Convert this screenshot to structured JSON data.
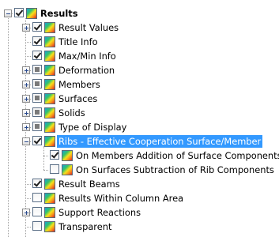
{
  "tree": [
    {
      "label": "Results",
      "level": 0,
      "expander": "expanded",
      "check": "checked",
      "bold": true
    },
    {
      "label": "Result Values",
      "level": 1,
      "expander": "collapsed",
      "check": "checked"
    },
    {
      "label": "Title Info",
      "level": 1,
      "expander": "none",
      "check": "checked"
    },
    {
      "label": "Max/Min Info",
      "level": 1,
      "expander": "none",
      "check": "checked"
    },
    {
      "label": "Deformation",
      "level": 1,
      "expander": "collapsed",
      "check": "partial"
    },
    {
      "label": "Members",
      "level": 1,
      "expander": "collapsed",
      "check": "partial"
    },
    {
      "label": "Surfaces",
      "level": 1,
      "expander": "collapsed",
      "check": "partial"
    },
    {
      "label": "Solids",
      "level": 1,
      "expander": "collapsed",
      "check": "partial"
    },
    {
      "label": "Type of Display",
      "level": 1,
      "expander": "collapsed",
      "check": "partial"
    },
    {
      "label": "Ribs - Effective Cooperation Surface/Member",
      "level": 1,
      "expander": "expanded",
      "check": "checked",
      "selected": true
    },
    {
      "label": "On Members Addition of Surface Components",
      "level": 2,
      "expander": "none",
      "check": "checked"
    },
    {
      "label": "On Surfaces Subtraction of Rib Components",
      "level": 2,
      "expander": "none",
      "check": "unchecked"
    },
    {
      "label": "Result Beams",
      "level": 1,
      "expander": "none",
      "check": "checked"
    },
    {
      "label": "Results Within Column Area",
      "level": 1,
      "expander": "none",
      "check": "unchecked"
    },
    {
      "label": "Support Reactions",
      "level": 1,
      "expander": "collapsed",
      "check": "unchecked"
    },
    {
      "label": "Transparent",
      "level": 1,
      "expander": "none",
      "check": "unchecked"
    }
  ],
  "colors": {
    "selection": "#3399ff",
    "tree_lines": "#a0a0a0"
  },
  "icon": "result-gradient-icon"
}
